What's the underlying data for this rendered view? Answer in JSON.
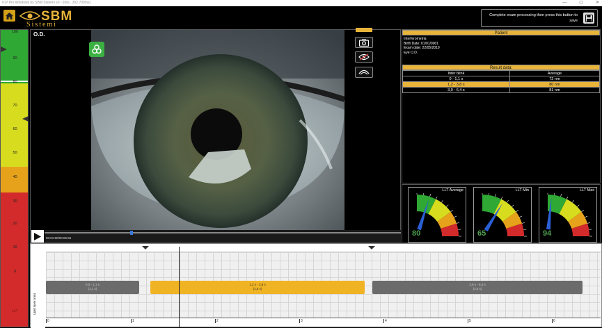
{
  "window": {
    "title": "ICP Pro Windows by SBM Sistemi srl - [Inte...302.790ms]",
    "controls": [
      "—",
      "▢",
      "✕"
    ]
  },
  "logo": {
    "brand": "SBM",
    "sub": "Sistemi",
    "color": "#e8b43a"
  },
  "save": {
    "label": "Complete exam processing then press this button to save"
  },
  "scale": {
    "ticks": [
      "100",
      "90",
      "80",
      "70",
      "60",
      "50",
      "40",
      "30",
      "20",
      "10",
      "0"
    ],
    "footer": "LLT"
  },
  "video": {
    "eye_label": "O.D.",
    "time": "00:01:50/00:06:56",
    "progress": 0.24
  },
  "patient": {
    "header": "Patient",
    "exam": "Interferometria",
    "birth": "Birth Date: 01/01/0001",
    "exam_date": "Exam date: 22/05/2019",
    "eye": "Eye O.D."
  },
  "results": {
    "header": "Result data:",
    "col1": "Inter blink",
    "col2": "Average",
    "rows": [
      {
        "interval": "0 - 1,1 s",
        "avg": "72 nm"
      },
      {
        "interval": "1,2 - 3,8 s",
        "avg": "80 nm"
      },
      {
        "interval": "3,9 - 6,4 s",
        "avg": "81 nm"
      }
    ]
  },
  "gauges": [
    {
      "title": "LLT Average",
      "value": "80"
    },
    {
      "title": "LLT Min",
      "value": "65"
    },
    {
      "title": "LLT Max",
      "value": "94"
    }
  ],
  "timeline": {
    "ylabel": "Lipid layer (nm)",
    "ticks": [
      "0",
      "1",
      "2",
      "3",
      "4",
      "5",
      "6"
    ],
    "bars": [
      {
        "label1": "0,0 - 1,1 s",
        "label2": "(1,1 s)",
        "color": "#6b6b6b"
      },
      {
        "label1": "1,2 s - 3,8 s",
        "label2": "(2,6 s)",
        "color": "#f0b323"
      },
      {
        "label1": "3,9 s - 6,4 s",
        "label2": "(2,5 s)",
        "color": "#6b6b6b"
      }
    ]
  }
}
